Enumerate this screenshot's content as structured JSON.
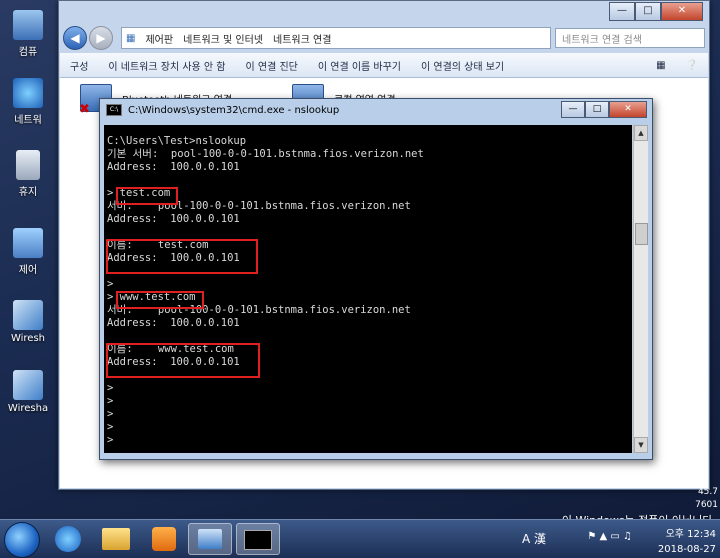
{
  "desktop": {
    "icons": [
      {
        "label": "컴퓨"
      },
      {
        "label": "네트워"
      },
      {
        "label": "휴지"
      },
      {
        "label": "제어"
      },
      {
        "label": "Wiresh"
      },
      {
        "label": "Wiresha"
      }
    ],
    "side_numbers": [
      "45.7",
      "7601"
    ],
    "watermark": "이 Windows는 정품이 아닙니다."
  },
  "explorer": {
    "breadcrumb": [
      "제어판",
      "네트워크 및 인터넷",
      "네트워크 연결"
    ],
    "search_placeholder": "네트워크 연결 검색",
    "toolbar": [
      "구성",
      "이 네트워크 장치 사용 안 함",
      "이 연결 진단",
      "이 연결 이름 바꾸기",
      "이 연결의 상태 보기"
    ],
    "connections": [
      "Bluetooth 네트워크 연결",
      "로컬 영역 연결"
    ]
  },
  "cmd": {
    "title": "C:\\Windows\\system32\\cmd.exe - nslookup",
    "lines": [
      "C:\\Users\\Test>nslookup",
      "기본 서버:  pool-100-0-0-101.bstnma.fios.verizon.net",
      "Address:  100.0.0.101",
      "",
      "> test.com",
      "서버:    pool-100-0-0-101.bstnma.fios.verizon.net",
      "Address:  100.0.0.101",
      "",
      "이름:    test.com",
      "Address:  100.0.0.101",
      "",
      ">",
      "> www.test.com",
      "서버:    pool-100-0-0-101.bstnma.fios.verizon.net",
      "Address:  100.0.0.101",
      "",
      "이름:    www.test.com",
      "Address:  100.0.0.101",
      "",
      ">",
      ">",
      ">",
      ">",
      ">"
    ]
  },
  "taskbar": {
    "time": "오후 12:34",
    "date": "2018-08-27",
    "ime": "A 漢"
  }
}
